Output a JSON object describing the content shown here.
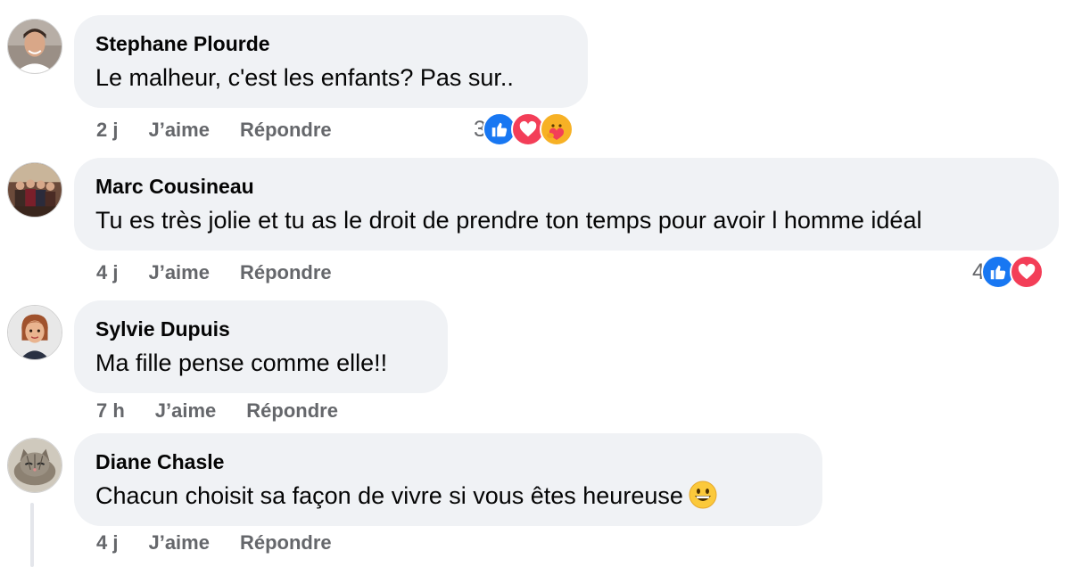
{
  "comments": [
    {
      "author": "Stephane Plourde",
      "text": "Le malheur, c'est les enfants? Pas sur..",
      "time": "2 j",
      "like": "J’aime",
      "reply": "Répondre",
      "reaction_count": "3",
      "reactions": [
        "like-icon",
        "love-icon",
        "care-icon"
      ]
    },
    {
      "author": "Marc Cousineau",
      "text": "Tu es très jolie et tu as le droit de prendre ton temps pour avoir l homme idéal",
      "time": "4 j",
      "like": "J’aime",
      "reply": "Répondre",
      "reaction_count": "4",
      "reactions": [
        "like-icon",
        "love-icon"
      ]
    },
    {
      "author": "Sylvie Dupuis",
      "text": "Ma fille pense comme elle!!",
      "time": "7 h",
      "like": "J’aime",
      "reply": "Répondre"
    },
    {
      "author": "Diane Chasle",
      "text": "Chacun choisit sa façon de vivre si vous êtes heureuse",
      "time": "4 j",
      "like": "J’aime",
      "reply": "Répondre",
      "trailing_emoji": "grinning-face-emoji"
    }
  ],
  "colors": {
    "bubble": "#f0f2f5",
    "meta_text": "#65676b",
    "like_blue": "#1877f2",
    "love_red": "#f33e58",
    "care_yellow": "#f7b125"
  }
}
